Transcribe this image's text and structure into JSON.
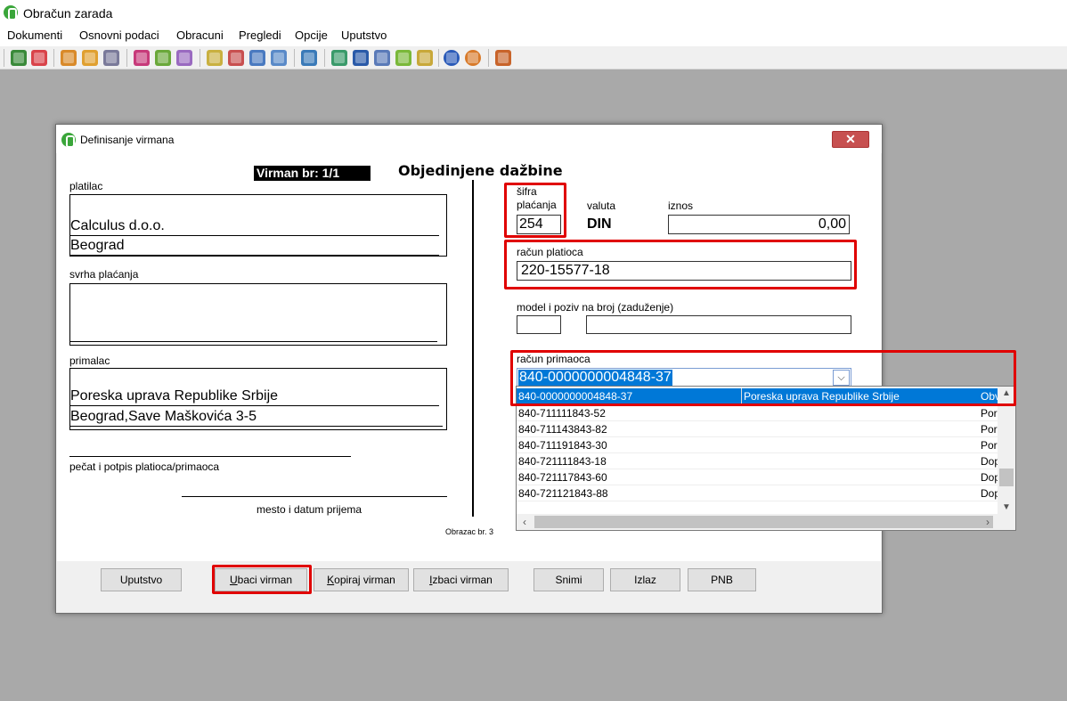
{
  "app": {
    "title": "Obračun zarada"
  },
  "menu": [
    "Dokumenti",
    "Osnovni podaci",
    "Obracuni",
    "Pregledi",
    "Opcije",
    "Uputstvo"
  ],
  "dialog": {
    "title": "Definisanje virmana",
    "close_label": "✕",
    "virman_no": "Virman br: 1/1",
    "heading": "Objedinjene dažbine",
    "form_number": "Obrazac br. 3",
    "platilac": {
      "label": "platilac",
      "line1": "Calculus d.o.o.",
      "line2": "Beograd"
    },
    "svrha": {
      "label": "svrha plaćanja"
    },
    "primalac": {
      "label": "primalac",
      "line1": "Poreska uprava Republike Srbije",
      "line2": "Beograd,Save Maškovića 3-5"
    },
    "pecat_label": "pečat i potpis platioca/primaoca",
    "mesto_label": "mesto i datum prijema",
    "sifra": {
      "label_line1": "šifra",
      "label_line2": "plaćanja",
      "value": "254"
    },
    "valuta": {
      "label": "valuta",
      "value": "DIN"
    },
    "iznos": {
      "label": "iznos",
      "value": "0,00"
    },
    "racun_platioca": {
      "label": "račun platioca",
      "value": "220-15577-18"
    },
    "model": {
      "label": "model i poziv na broj (zaduženje)"
    },
    "racun_primaoca": {
      "label": "račun primaoca",
      "value": "840-0000000004848-37",
      "options": [
        {
          "account": "840-0000000004848-37",
          "name": "Poreska uprava Republike Srbije",
          "extra": "Obv",
          "selected": true
        },
        {
          "account": "840-711111843-52",
          "name": "",
          "extra": "Por"
        },
        {
          "account": "840-711143843-82",
          "name": "",
          "extra": "Por"
        },
        {
          "account": "840-711191843-30",
          "name": "",
          "extra": "Por"
        },
        {
          "account": "840-721111843-18",
          "name": "",
          "extra": "Dop"
        },
        {
          "account": "840-721117843-60",
          "name": "",
          "extra": "Dop"
        },
        {
          "account": "840-721121843-88",
          "name": "",
          "extra": "Dop"
        }
      ]
    },
    "buttons": {
      "uputstvo": "Uputstvo",
      "ubaci_u": "U",
      "ubaci_rest": "baci virman",
      "kopiraj_u": "K",
      "kopiraj_rest": "opiraj virman",
      "izbaci_u": "I",
      "izbaci_rest": "zbaci virman",
      "snimi": "Snimi",
      "izlaz": "Izlaz",
      "pnb": "PNB"
    }
  },
  "colors": {
    "highlight": "#e00000",
    "selection": "#0078d7"
  }
}
